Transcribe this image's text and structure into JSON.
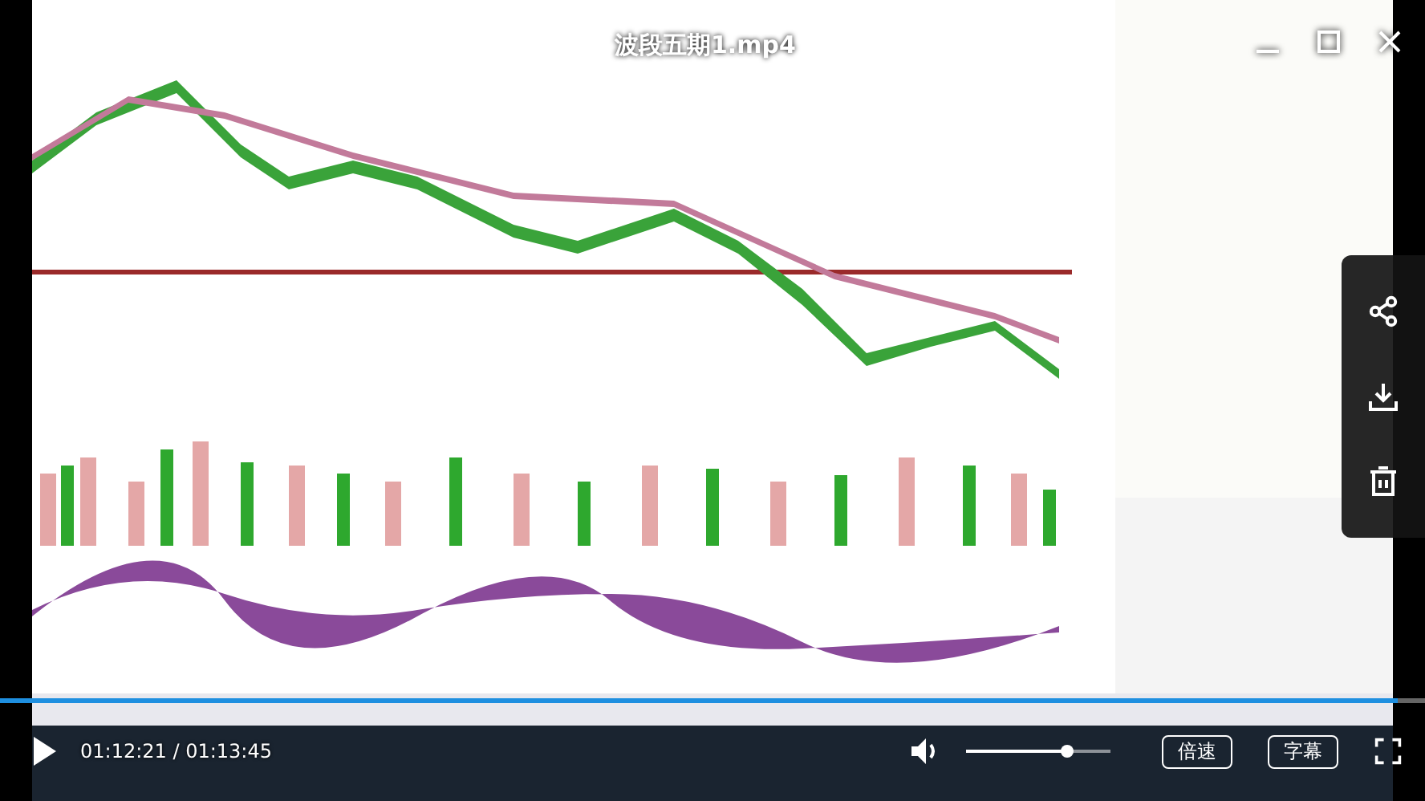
{
  "title": "波段五期1.mp4",
  "progress": {
    "level": 0.981
  },
  "time": "01:12:21 / 01:13:45",
  "volume": {
    "level": 0.7
  },
  "buttons": [
    "倍速",
    "字幕"
  ]
}
